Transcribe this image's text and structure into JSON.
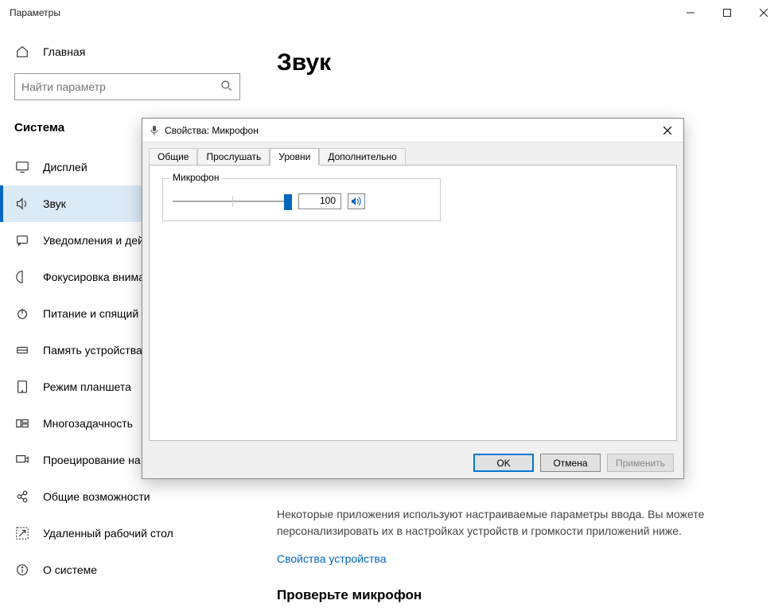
{
  "window": {
    "title": "Параметры"
  },
  "sidebar": {
    "home_label": "Главная",
    "search_placeholder": "Найти параметр",
    "section_label": "Система",
    "items": [
      {
        "label": "Дисплей",
        "icon": "display-icon"
      },
      {
        "label": "Звук",
        "icon": "sound-icon"
      },
      {
        "label": "Уведомления и действия",
        "icon": "notifications-icon"
      },
      {
        "label": "Фокусировка внимания",
        "icon": "focus-icon"
      },
      {
        "label": "Питание и спящий режим",
        "icon": "power-icon"
      },
      {
        "label": "Память устройства",
        "icon": "storage-icon"
      },
      {
        "label": "Режим планшета",
        "icon": "tablet-icon"
      },
      {
        "label": "Многозадачность",
        "icon": "multitask-icon"
      },
      {
        "label": "Проецирование на этот компьютер",
        "icon": "projecting-icon"
      },
      {
        "label": "Общие возможности",
        "icon": "shared-icon"
      },
      {
        "label": "Удаленный рабочий стол",
        "icon": "remote-icon"
      },
      {
        "label": "О системе",
        "icon": "about-icon"
      }
    ],
    "active_index": 1
  },
  "main": {
    "title": "Звук",
    "body_text": "Некоторые приложения используют настраиваемые параметры ввода. Вы можете персонализировать их в настройках устройств и громкости приложений ниже.",
    "link_label": "Свойства устройства",
    "subhead": "Проверьте микрофон"
  },
  "dialog": {
    "title": "Свойства: Микрофон",
    "tabs": [
      "Общие",
      "Прослушать",
      "Уровни",
      "Дополнительно"
    ],
    "active_tab_index": 2,
    "group_label": "Микрофон",
    "level_value": "100",
    "slider_percent": 100,
    "buttons": {
      "ok": "OK",
      "cancel": "Отмена",
      "apply": "Применить"
    }
  }
}
